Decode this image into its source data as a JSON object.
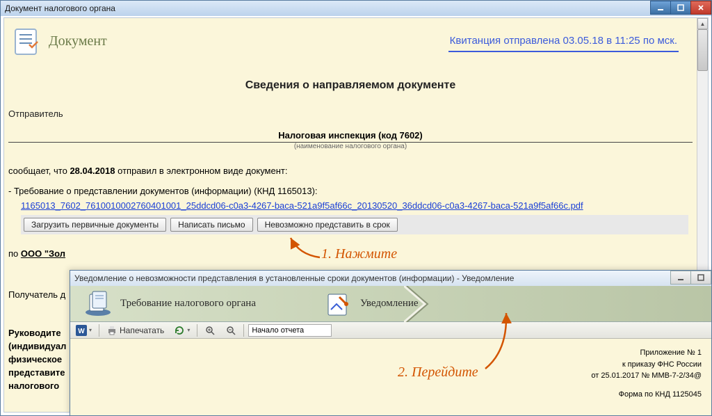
{
  "main_window": {
    "title": "Документ налогового органа",
    "header": {
      "doc_label": "Документ",
      "receipt_link": "Квитанция отправлена 03.05.18 в 11:25 по мск."
    },
    "section_title": "Сведения о направляемом документе",
    "sender_label": "Отправитель",
    "sender_value": "Налоговая инспекция (код 7602)",
    "sender_caption": "(наименование налогового органа)",
    "informs_prefix": "сообщает, что ",
    "informs_date": "28.04.2018",
    "informs_suffix": " отправил в электронном виде документ:",
    "doc_item_label": "-  Требование о представлении документов (информации) (КНД 1165013):",
    "doc_link": "1165013_7602_7610010002760401001_25ddcd06-c0a3-4267-baca-521a9f5af66c_20130520_36ddcd06-c0a3-4267-baca-521a9f5af66c.pdf",
    "buttons": {
      "load": "Загрузить первичные документы",
      "write": "Написать письмо",
      "impossible": "Невозможно представить в срок"
    },
    "recipient_prefix": "по  ",
    "recipient_value": "ООО \"Зол",
    "extra_label": "Получатель д",
    "bottom_lines": [
      "Руководите",
      "(индивидуал",
      "физическое",
      "представите",
      "налогового"
    ]
  },
  "annotations": {
    "step1": "1. Нажмите",
    "step2": "2. Перейдите"
  },
  "sub_window": {
    "title": "Уведомление о невозможности представления в установленные сроки документов (информации) - Уведомление",
    "wizard": {
      "step1": "Требование налогового органа",
      "step2": "Уведомление"
    },
    "toolbar": {
      "print": "Напечатать",
      "search_value": "Начало отчета"
    },
    "meta": {
      "line1": "Приложение № 1",
      "line2": "к приказу ФНС России",
      "line3": "от 25.01.2017 № ММВ-7-2/34@",
      "line4": "Форма по КНД 1125045"
    }
  }
}
